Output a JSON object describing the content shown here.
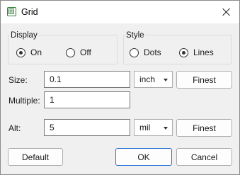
{
  "window": {
    "title": "Grid",
    "app_icon": "grid-icon",
    "close_icon": "close-icon"
  },
  "display": {
    "title": "Display",
    "options": [
      {
        "label": "On",
        "checked": true
      },
      {
        "label": "Off",
        "checked": false
      }
    ]
  },
  "style": {
    "title": "Style",
    "options": [
      {
        "label": "Dots",
        "checked": false
      },
      {
        "label": "Lines",
        "checked": true
      }
    ]
  },
  "size": {
    "label": "Size:",
    "value": "0.1",
    "unit": "inch",
    "button": "Finest"
  },
  "multiple": {
    "label": "Multiple:",
    "value": "1"
  },
  "alt": {
    "label": "Alt:",
    "value": "5",
    "unit": "mil",
    "button": "Finest"
  },
  "footer": {
    "default": "Default",
    "ok": "OK",
    "cancel": "Cancel"
  },
  "colors": {
    "accent": "#2a72d6",
    "icon": "#2e7d32"
  }
}
